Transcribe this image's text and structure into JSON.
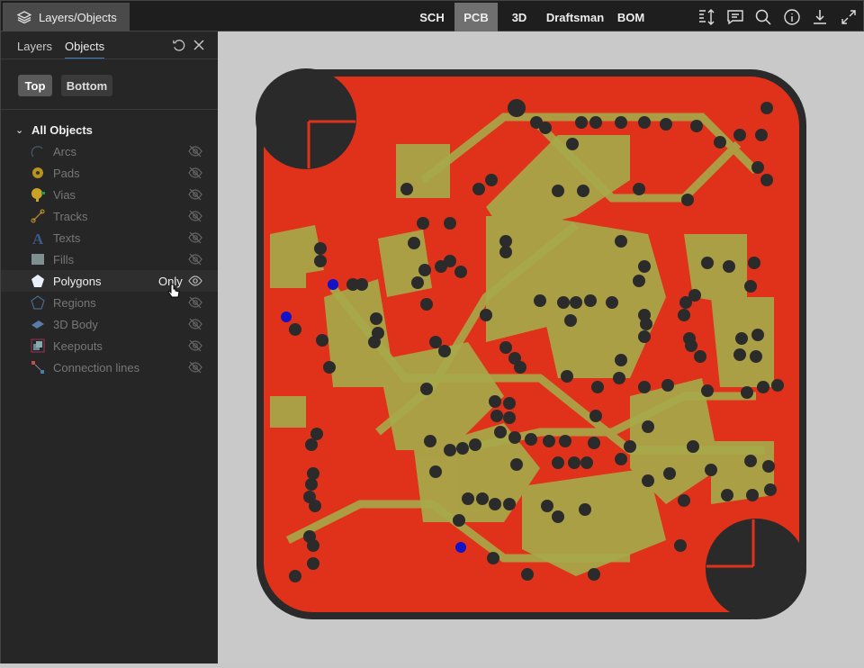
{
  "topbar": {
    "layers_tab": "Layers/Objects",
    "tabs": [
      "SCH",
      "PCB",
      "3D",
      "Draftsman",
      "BOM"
    ],
    "active_tab": "PCB",
    "icons": [
      "sort-height-icon",
      "comment-icon",
      "search-icon",
      "info-icon",
      "download-icon",
      "expand-icon"
    ]
  },
  "panel": {
    "tabs": [
      "Layers",
      "Objects"
    ],
    "active_tab": "Objects",
    "side_buttons": [
      "Top",
      "Bottom"
    ],
    "active_side": "Top",
    "group": "All Objects",
    "items": [
      {
        "label": "Arcs",
        "visible": false
      },
      {
        "label": "Pads",
        "visible": false
      },
      {
        "label": "Vias",
        "visible": false
      },
      {
        "label": "Tracks",
        "visible": false
      },
      {
        "label": "Texts",
        "visible": false
      },
      {
        "label": "Fills",
        "visible": false
      },
      {
        "label": "Polygons",
        "visible": true,
        "hover_action": "Only"
      },
      {
        "label": "Regions",
        "visible": false
      },
      {
        "label": "3D Body",
        "visible": false
      },
      {
        "label": "Keepouts",
        "visible": false
      },
      {
        "label": "Connection lines",
        "visible": false
      }
    ]
  },
  "colors": {
    "board": "#2a2a2a",
    "copper": "#e0321a",
    "polygon": "#a7a94a",
    "via": "#2b2b2b",
    "accent": "#3d7ec2"
  }
}
